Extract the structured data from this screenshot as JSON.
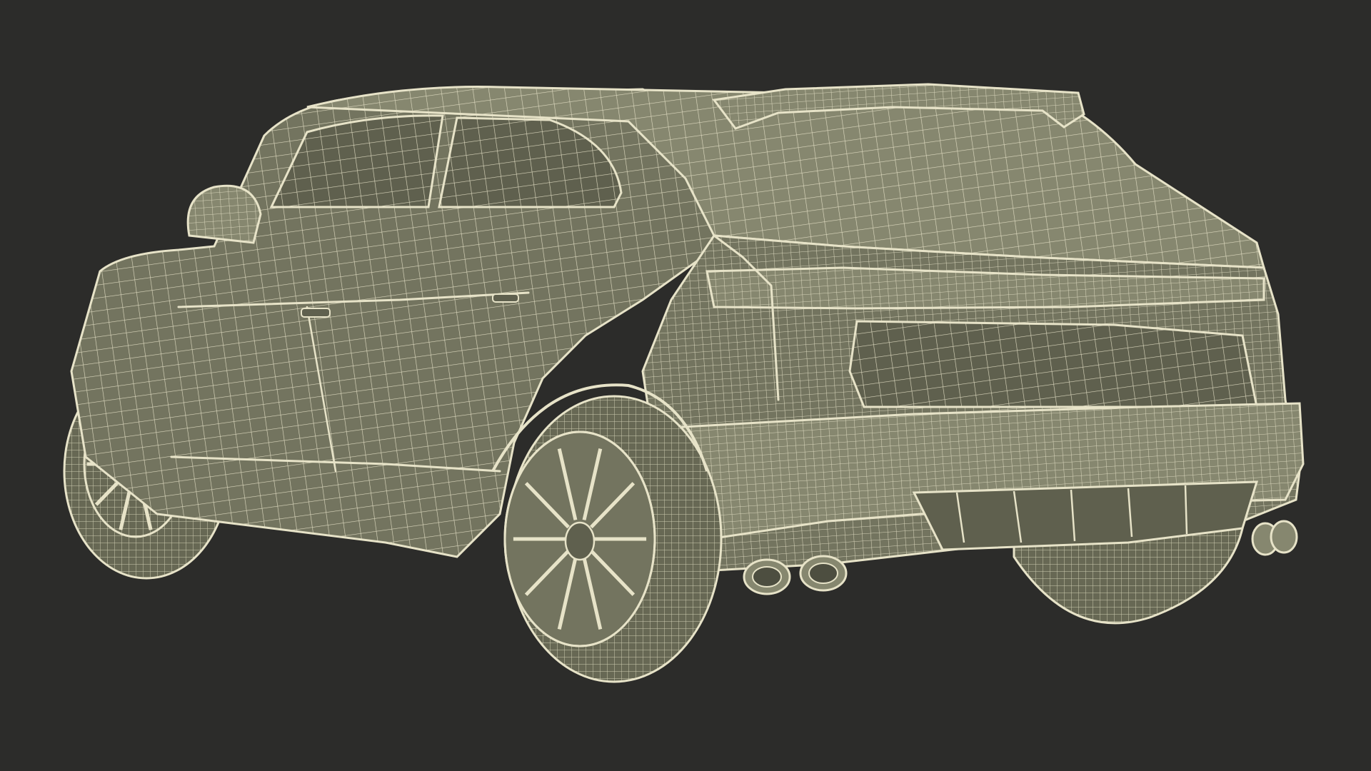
{
  "scene": {
    "subject": "wireframe-render-suv-rear-three-quarter",
    "colors": {
      "background": "#2c2c2a",
      "surface": "#73745f",
      "surface_dark": "#5f604e",
      "surface_light": "#86876f",
      "wire": "#e7e3c8",
      "tire": "#676854"
    }
  }
}
